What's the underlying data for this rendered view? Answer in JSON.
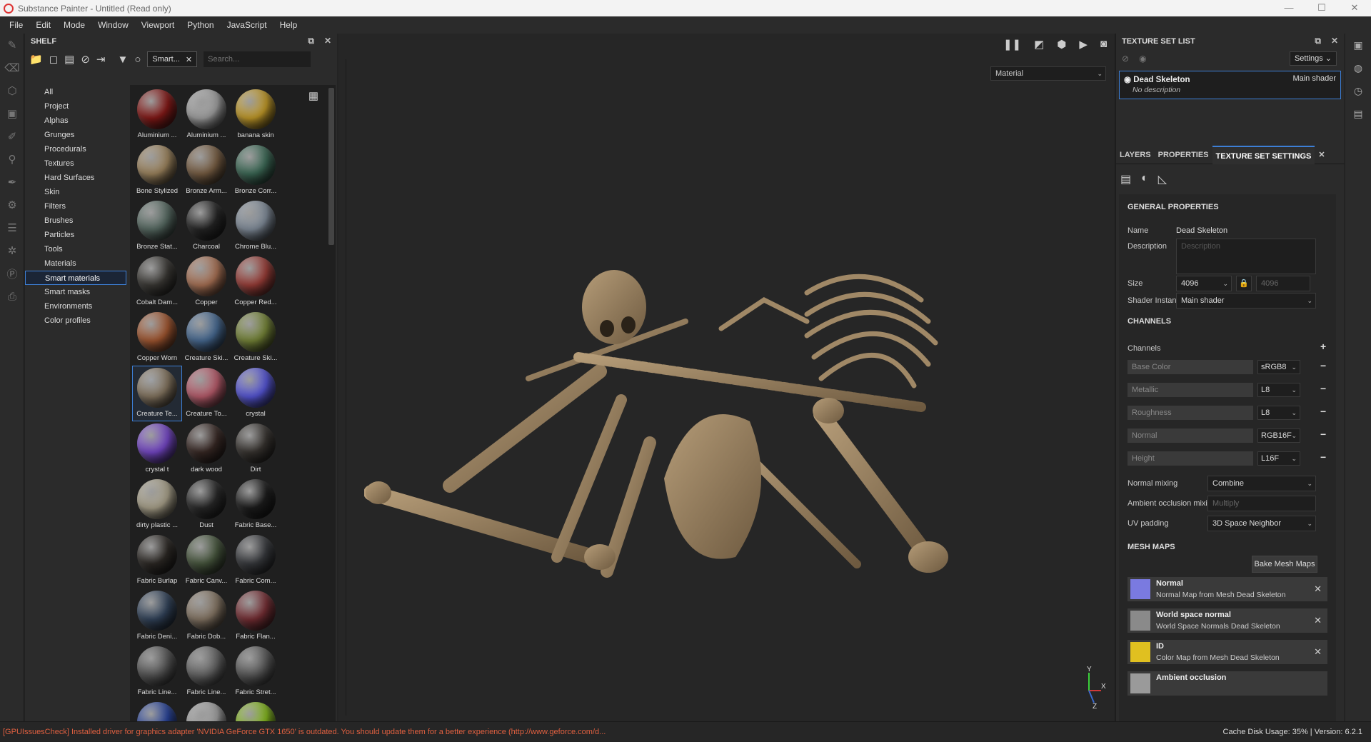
{
  "window": {
    "title": "Substance Painter - Untitled (Read only)",
    "controls": [
      "—",
      "☐",
      "✕"
    ]
  },
  "menu": [
    "File",
    "Edit",
    "Mode",
    "Window",
    "Viewport",
    "Python",
    "JavaScript",
    "Help"
  ],
  "shelf": {
    "title": "SHELF",
    "filter_chip": "Smart...",
    "search_placeholder": "Search...",
    "categories": [
      "All",
      "Project",
      "Alphas",
      "Grunges",
      "Procedurals",
      "Textures",
      "Hard Surfaces",
      "Skin",
      "Filters",
      "Brushes",
      "Particles",
      "Tools",
      "Materials",
      "Smart materials",
      "Smart masks",
      "Environments",
      "Color profiles"
    ],
    "selected_category": "Smart materials",
    "materials": [
      {
        "label": "Aluminium ...",
        "color": "#8a1a18"
      },
      {
        "label": "Aluminium ...",
        "color": "#a8a8a8"
      },
      {
        "label": "banana skin",
        "color": "#c9a02a"
      },
      {
        "label": "Bone Stylized",
        "color": "#a48a62"
      },
      {
        "label": "Bronze Arm...",
        "color": "#7d6246"
      },
      {
        "label": "Bronze Corr...",
        "color": "#3f6e5a"
      },
      {
        "label": "Bronze Stat...",
        "color": "#5a6e66"
      },
      {
        "label": "Charcoal",
        "color": "#262626"
      },
      {
        "label": "Chrome Blu...",
        "color": "#8692a0"
      },
      {
        "label": "Cobalt Dam...",
        "color": "#3c3a36"
      },
      {
        "label": "Copper",
        "color": "#b07658"
      },
      {
        "label": "Copper Red...",
        "color": "#a0403a"
      },
      {
        "label": "Copper Worn",
        "color": "#a85a32"
      },
      {
        "label": "Creature Ski...",
        "color": "#4a6e98"
      },
      {
        "label": "Creature Ski...",
        "color": "#7a8a3a"
      },
      {
        "label": "Creature Te...",
        "color": "#8a7a64"
      },
      {
        "label": "Creature To...",
        "color": "#c06070"
      },
      {
        "label": "crystal",
        "color": "#5a5ae0"
      },
      {
        "label": "crystal t",
        "color": "#7a4ad0"
      },
      {
        "label": "dark wood",
        "color": "#3a2a26"
      },
      {
        "label": "Dirt",
        "color": "#3a3632"
      },
      {
        "label": "dirty plastic ...",
        "color": "#b0a890"
      },
      {
        "label": "Dust",
        "color": "#2a2a2a"
      },
      {
        "label": "Fabric Base...",
        "color": "#1e1e1e"
      },
      {
        "label": "Fabric Burlap",
        "color": "#2e2a26"
      },
      {
        "label": "Fabric Canv...",
        "color": "#4a5a40"
      },
      {
        "label": "Fabric Com...",
        "color": "#3a3c40"
      },
      {
        "label": "Fabric Deni...",
        "color": "#34465e"
      },
      {
        "label": "Fabric Dob...",
        "color": "#8a7a68"
      },
      {
        "label": "Fabric Flan...",
        "color": "#7a3036"
      },
      {
        "label": "Fabric Line...",
        "color": "#5a5a5a"
      },
      {
        "label": "Fabric Line...",
        "color": "#6a6a6a"
      },
      {
        "label": "Fabric Stret...",
        "color": "#5e5e5e"
      },
      {
        "label": "",
        "color": "#2a46a0"
      },
      {
        "label": "",
        "color": "#a8a8a8"
      },
      {
        "label": "",
        "color": "#8ac020"
      }
    ],
    "selected_material_index": 15
  },
  "viewport": {
    "material_select": "Material",
    "axes": {
      "y": "Y",
      "x": "X",
      "z": "Z"
    }
  },
  "texture_set_list": {
    "title": "TEXTURE SET LIST",
    "settings_btn": "Settings",
    "item": {
      "name": "Dead Skeleton",
      "shader": "Main shader",
      "description": "No description"
    }
  },
  "tabs": [
    "LAYERS",
    "PROPERTIES",
    "TEXTURE SET SETTINGS"
  ],
  "active_tab": "TEXTURE SET SETTINGS",
  "tss": {
    "general_title": "GENERAL PROPERTIES",
    "name_label": "Name",
    "name_value": "Dead Skeleton",
    "description_label": "Description",
    "description_placeholder": "Description",
    "size_label": "Size",
    "size_value": "4096",
    "size_value2": "4096",
    "shader_label": "Shader Instance",
    "shader_value": "Main shader",
    "channels_title": "CHANNELS",
    "channels_label": "Channels",
    "channels": [
      {
        "name": "Base Color",
        "format": "sRGB8"
      },
      {
        "name": "Metallic",
        "format": "L8"
      },
      {
        "name": "Roughness",
        "format": "L8"
      },
      {
        "name": "Normal",
        "format": "RGB16F"
      },
      {
        "name": "Height",
        "format": "L16F"
      }
    ],
    "normal_mixing_label": "Normal mixing",
    "normal_mixing_value": "Combine",
    "ao_mixing_label": "Ambient occlusion mixing",
    "ao_mixing_value": "Multiply",
    "uv_padding_label": "UV padding",
    "uv_padding_value": "3D Space Neighbor",
    "mesh_maps_title": "MESH MAPS",
    "bake_btn": "Bake Mesh Maps",
    "mesh_maps": [
      {
        "title": "Normal",
        "subtitle": "Normal Map from Mesh Dead Skeleton",
        "color": "#7a7ae0"
      },
      {
        "title": "World space normal",
        "subtitle": "World Space Normals Dead Skeleton",
        "color": "#8a8a8a"
      },
      {
        "title": "ID",
        "subtitle": "Color Map from Mesh Dead Skeleton",
        "color": "#e0c020"
      },
      {
        "title": "Ambient occlusion",
        "subtitle": "",
        "color": "#9a9a9a"
      }
    ]
  },
  "status": {
    "error": "[GPUIssuesCheck] Installed driver for graphics adapter 'NVIDIA GeForce GTX 1650' is outdated. You should update them for a better experience (http://www.geforce.com/d...",
    "right": "Cache Disk Usage:   35% | Version: 6.2.1"
  }
}
